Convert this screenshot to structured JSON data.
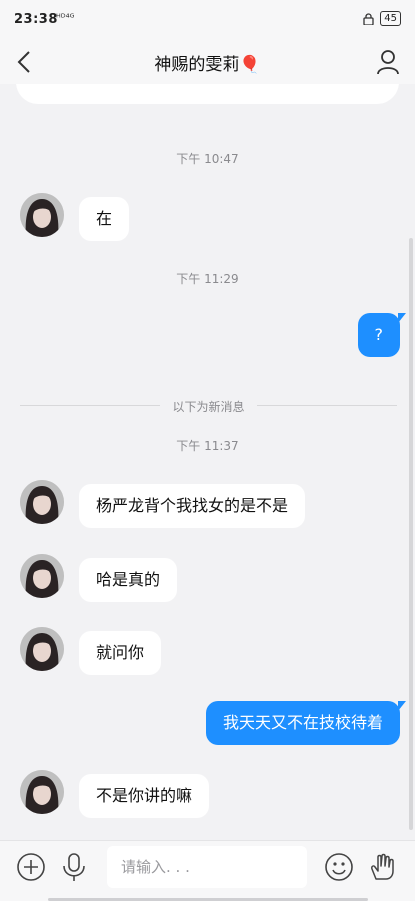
{
  "status_bar": {
    "time": "23:38",
    "network": "ᴴᴰ⁴ᴳ",
    "battery": "45"
  },
  "header": {
    "title": "神赐的雯莉",
    "title_emoji": "🎈",
    "back_icon": "chevron-left-icon",
    "profile_icon": "person-icon"
  },
  "chat": {
    "stamps": [
      "下午 10:47",
      "下午 11:29",
      "下午 11:37"
    ],
    "new_messages_divider": "以下为新消息",
    "messages": [
      {
        "from": "other",
        "text": "在"
      },
      {
        "from": "me",
        "text": "?"
      },
      {
        "from": "other",
        "text": "杨严龙背个我找女的是不是"
      },
      {
        "from": "other",
        "text": "哈是真的"
      },
      {
        "from": "other",
        "text": "就问你"
      },
      {
        "from": "me",
        "text": "我天天又不在技校待着"
      },
      {
        "from": "other",
        "text": "不是你讲的嘛"
      }
    ]
  },
  "input_bar": {
    "placeholder": "请输入. . .",
    "icons": [
      "add-icon",
      "microphone-icon",
      "emoji-icon",
      "gesture-icon"
    ]
  },
  "colors": {
    "accent": "#1e8fff",
    "background": "#f2f2f4",
    "bubble_in": "#ffffff"
  }
}
